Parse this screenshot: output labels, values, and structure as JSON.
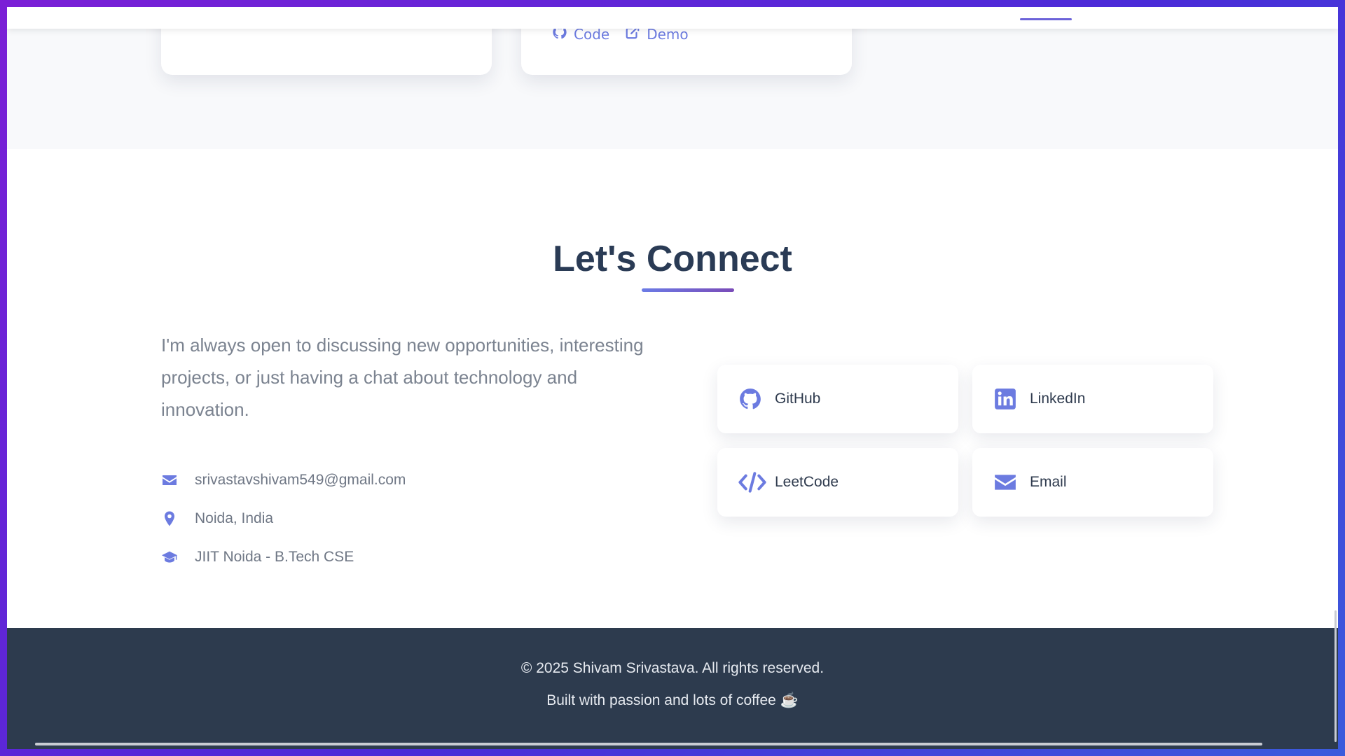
{
  "project_card": {
    "code_label": "Code",
    "demo_label": "Demo"
  },
  "connect": {
    "title": "Let's Connect",
    "intro": "I'm always open to discussing new opportunities, interesting projects, or just having a chat about technology and innovation.",
    "info": [
      {
        "icon": "envelope-icon",
        "text": "srivastavshivam549@gmail.com"
      },
      {
        "icon": "location-pin-icon",
        "text": "Noida, India"
      },
      {
        "icon": "graduation-cap-icon",
        "text": "JIIT Noida - B.Tech CSE"
      }
    ],
    "links": [
      {
        "icon": "github-icon",
        "label": "GitHub"
      },
      {
        "icon": "linkedin-icon",
        "label": "LinkedIn"
      },
      {
        "icon": "code-icon",
        "label": "LeetCode"
      },
      {
        "icon": "envelope-icon",
        "label": "Email"
      }
    ]
  },
  "footer": {
    "copyright": "© 2025 Shivam Srivastava. All rights reserved.",
    "built_with": "Built with passion and lots of coffee ☕"
  },
  "colors": {
    "accent": "#6c7be0",
    "heading": "#2a3b55",
    "footer_bg": "#2d3b4e"
  }
}
